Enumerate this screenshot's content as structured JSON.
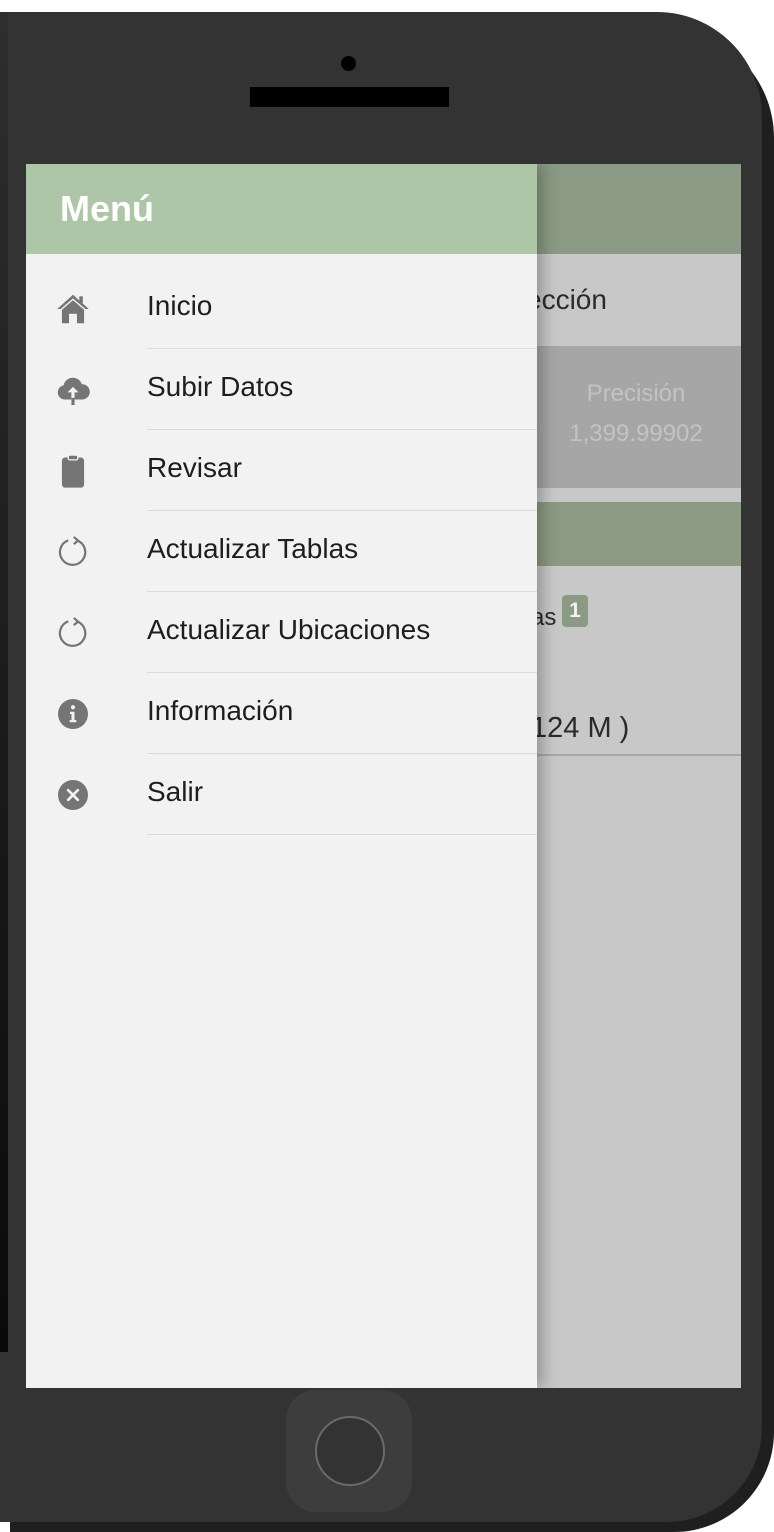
{
  "drawer": {
    "title": "Menú",
    "items": [
      {
        "label": "Inicio",
        "icon": "home-icon"
      },
      {
        "label": "Subir Datos",
        "icon": "cloud-upload-icon"
      },
      {
        "label": "Revisar",
        "icon": "clipboard-icon"
      },
      {
        "label": "Actualizar Tablas",
        "icon": "refresh-icon"
      },
      {
        "label": "Actualizar Ubicaciones",
        "icon": "refresh-icon"
      },
      {
        "label": "Información",
        "icon": "info-icon"
      },
      {
        "label": "Salir",
        "icon": "close-circle-icon"
      }
    ]
  },
  "background": {
    "row_text": "ección",
    "precision_label": "Precisión",
    "precision_value": "1,399.99902",
    "tablas_text": "as",
    "tablas_badge": "1",
    "value_text": "124 M )"
  },
  "colors": {
    "drawer_header": "#adc6a8",
    "app_header": "#8a9a84",
    "drawer_bg": "#f2f2f2",
    "icon": "#757575"
  }
}
